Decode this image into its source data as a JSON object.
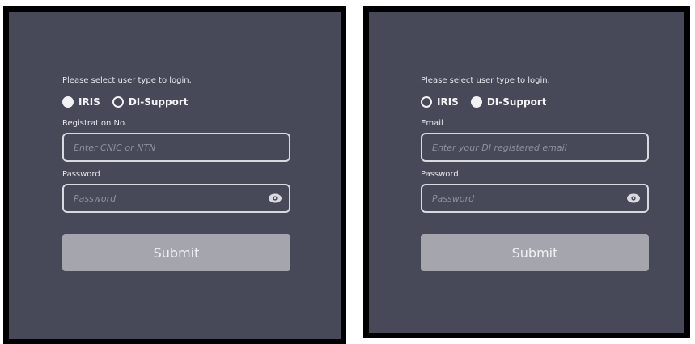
{
  "login_iris": {
    "prompt": "Please select user type to login.",
    "user_types": [
      {
        "label": "IRIS",
        "selected": true
      },
      {
        "label": "DI-Support",
        "selected": false
      }
    ],
    "id_field": {
      "label": "Registration No.",
      "placeholder": "Enter CNIC or NTN",
      "value": ""
    },
    "password_field": {
      "label": "Password",
      "placeholder": "Password",
      "value": ""
    },
    "submit_label": "Submit"
  },
  "login_di_support": {
    "prompt": "Please select user type to login.",
    "user_types": [
      {
        "label": "IRIS",
        "selected": false
      },
      {
        "label": "DI-Support",
        "selected": true
      }
    ],
    "id_field": {
      "label": "Email",
      "placeholder": "Enter your DI registered email",
      "value": ""
    },
    "password_field": {
      "label": "Password",
      "placeholder": "Password",
      "value": ""
    },
    "submit_label": "Submit"
  },
  "icons": {
    "password_toggle": "eye-icon",
    "radio_selected": "radio-filled",
    "radio_unselected": "radio-empty"
  },
  "colors": {
    "panel_background": "#474959",
    "panel_border": "#000000",
    "input_border": "#d9dae0",
    "submit_background": "#a5a6ad",
    "text": "#f4f4f6"
  }
}
